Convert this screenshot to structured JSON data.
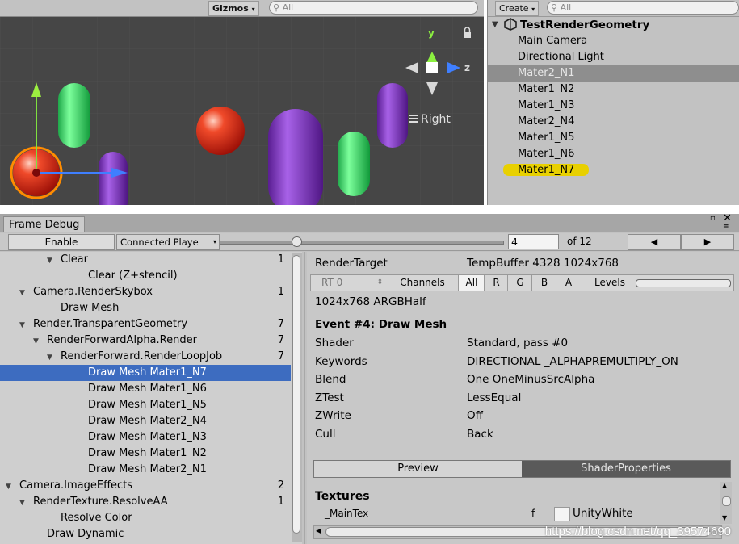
{
  "scene": {
    "gizmos_label": "Gizmos",
    "search_placeholder": "All",
    "orientation_label": "Right",
    "axis_y": "y",
    "axis_z": "z",
    "colors": {
      "bg": "#464646",
      "green": "#3fe06a",
      "purple": "#8a3fc8",
      "red": "#e23a2a",
      "orange": "#ff8c00"
    }
  },
  "hierarchy": {
    "create_label": "Create",
    "search_placeholder": "All",
    "root": "TestRenderGeometry",
    "items": [
      {
        "label": "Main Camera",
        "state": "normal"
      },
      {
        "label": "Directional Light",
        "state": "normal"
      },
      {
        "label": "Mater2_N1",
        "state": "selected"
      },
      {
        "label": "Mater1_N2",
        "state": "normal"
      },
      {
        "label": "Mater1_N3",
        "state": "normal"
      },
      {
        "label": "Mater2_N4",
        "state": "normal"
      },
      {
        "label": "Mater1_N5",
        "state": "normal"
      },
      {
        "label": "Mater1_N6",
        "state": "normal"
      },
      {
        "label": "Mater1_N7",
        "state": "highlighted"
      }
    ]
  },
  "frame_debug": {
    "tab_label": "Frame Debug",
    "enable_label": "Enable",
    "connected_label": "Connected Playe",
    "frame_value": "4",
    "frame_total": "of 12",
    "slider_fraction": 0.27,
    "prev_glyph": "◀",
    "next_glyph": "▶",
    "tree": [
      {
        "label": "Clear",
        "indent": 3,
        "expanded": true,
        "count": "1"
      },
      {
        "label": "Clear (Z+stencil)",
        "indent": 5,
        "expanded": null,
        "count": ""
      },
      {
        "label": "Camera.RenderSkybox",
        "indent": 1,
        "expanded": true,
        "count": "1"
      },
      {
        "label": "Draw Mesh",
        "indent": 3,
        "expanded": null,
        "count": ""
      },
      {
        "label": "Render.TransparentGeometry",
        "indent": 1,
        "expanded": true,
        "count": "7"
      },
      {
        "label": "RenderForwardAlpha.Render",
        "indent": 2,
        "expanded": true,
        "count": "7"
      },
      {
        "label": "RenderForward.RenderLoopJob",
        "indent": 3,
        "expanded": true,
        "count": "7"
      },
      {
        "label": "Draw Mesh Mater1_N7",
        "indent": 5,
        "expanded": null,
        "count": "",
        "selected": true
      },
      {
        "label": "Draw Mesh Mater1_N6",
        "indent": 5,
        "expanded": null,
        "count": ""
      },
      {
        "label": "Draw Mesh Mater1_N5",
        "indent": 5,
        "expanded": null,
        "count": ""
      },
      {
        "label": "Draw Mesh Mater2_N4",
        "indent": 5,
        "expanded": null,
        "count": ""
      },
      {
        "label": "Draw Mesh Mater1_N3",
        "indent": 5,
        "expanded": null,
        "count": ""
      },
      {
        "label": "Draw Mesh Mater1_N2",
        "indent": 5,
        "expanded": null,
        "count": ""
      },
      {
        "label": "Draw Mesh Mater2_N1",
        "indent": 5,
        "expanded": null,
        "count": ""
      },
      {
        "label": "Camera.ImageEffects",
        "indent": 0,
        "expanded": true,
        "count": "2"
      },
      {
        "label": "RenderTexture.ResolveAA",
        "indent": 1,
        "expanded": true,
        "count": "1"
      },
      {
        "label": "Resolve Color",
        "indent": 3,
        "expanded": null,
        "count": ""
      },
      {
        "label": "Draw Dynamic",
        "indent": 2,
        "expanded": null,
        "count": ""
      }
    ],
    "details": {
      "render_target_label": "RenderTarget",
      "render_target_value": "TempBuffer 4328 1024x768",
      "rt_select": "RT 0",
      "channels_label": "Channels",
      "channels": [
        "All",
        "R",
        "G",
        "B",
        "A"
      ],
      "levels_label": "Levels",
      "format": "1024x768 ARGBHalf",
      "event_title": "Event #4: Draw Mesh",
      "props": [
        {
          "label": "Shader",
          "value": "Standard, pass #0"
        },
        {
          "label": "Keywords",
          "value": "DIRECTIONAL _ALPHAPREMULTIPLY_ON"
        },
        {
          "label": "Blend",
          "value": "One OneMinusSrcAlpha"
        },
        {
          "label": "ZTest",
          "value": "LessEqual"
        },
        {
          "label": "ZWrite",
          "value": "Off"
        },
        {
          "label": "Cull",
          "value": "Back"
        }
      ],
      "tab_preview": "Preview",
      "tab_shader": "ShaderProperties",
      "textures_label": "Textures",
      "tex_name": "_MainTex",
      "tex_stage": "f",
      "tex_value": "UnityWhite"
    }
  },
  "watermark": "https://blog.csdn.net/qq_39574690"
}
